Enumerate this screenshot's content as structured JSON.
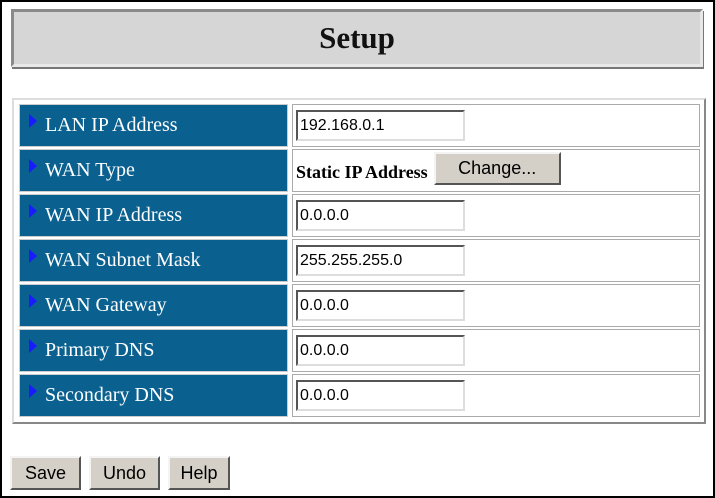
{
  "header": {
    "title": "Setup"
  },
  "rows": [
    {
      "label": "LAN IP Address",
      "value": "192.168.0.1"
    },
    {
      "label": "WAN Type",
      "value": "Static IP Address",
      "button": "Change..."
    },
    {
      "label": "WAN IP Address",
      "value": "0.0.0.0"
    },
    {
      "label": "WAN Subnet Mask",
      "value": "255.255.255.0"
    },
    {
      "label": "WAN Gateway",
      "value": "0.0.0.0"
    },
    {
      "label": "Primary DNS",
      "value": "0.0.0.0"
    },
    {
      "label": "Secondary DNS",
      "value": "0.0.0.0"
    }
  ],
  "buttons": {
    "save": "Save",
    "undo": "Undo",
    "help": "Help"
  }
}
